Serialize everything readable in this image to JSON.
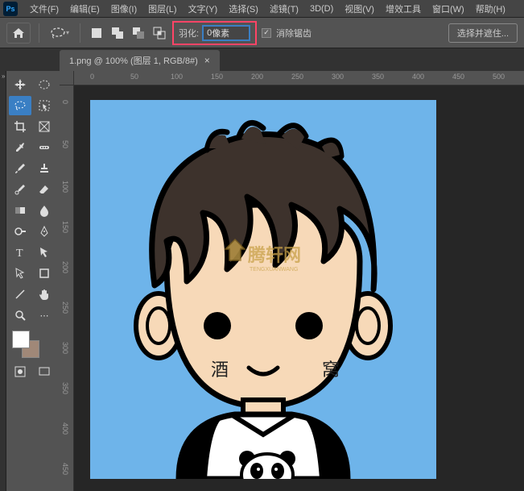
{
  "menu": {
    "file": "文件(F)",
    "edit": "编辑(E)",
    "image": "图像(I)",
    "layer": "图层(L)",
    "type": "文字(Y)",
    "select": "选择(S)",
    "filter": "滤镜(T)",
    "3d": "3D(D)",
    "view": "视图(V)",
    "plugins": "增效工具",
    "window": "窗口(W)",
    "help": "帮助(H)"
  },
  "options": {
    "feather_label": "羽化:",
    "feather_value": "0",
    "feather_unit": "像素",
    "antialias": "消除锯齿",
    "select_mask": "选择并遮住..."
  },
  "tab": {
    "title": "1.png @ 100% (图层 1, RGB/8#)"
  },
  "ruler": {
    "h": [
      "0",
      "50",
      "100",
      "150",
      "200",
      "250",
      "300",
      "350",
      "400",
      "450",
      "500"
    ],
    "v": [
      "0",
      "50",
      "100",
      "150",
      "200",
      "250",
      "300",
      "350",
      "400",
      "450"
    ]
  },
  "canvas": {
    "char1": "酒",
    "char2": "窝",
    "wm": "腾轩网"
  }
}
